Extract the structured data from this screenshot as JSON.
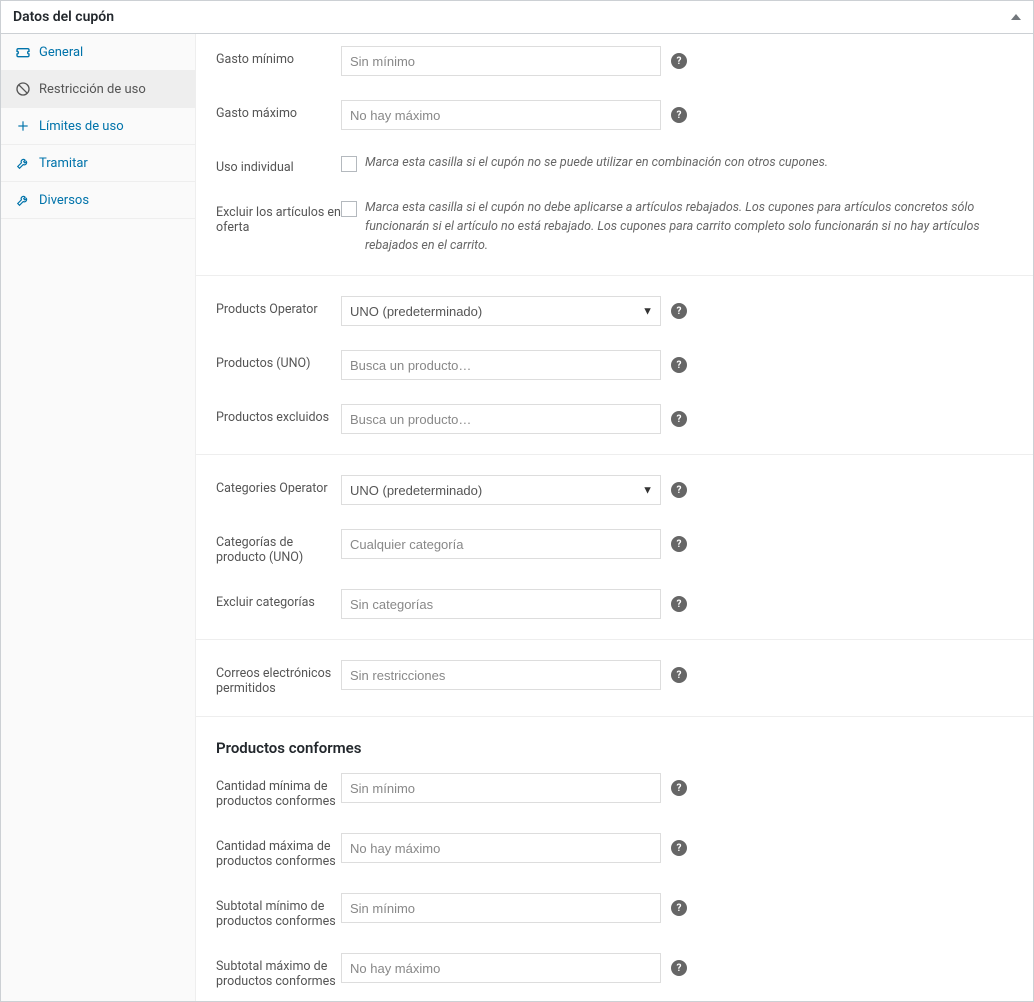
{
  "panel_title": "Datos del cupón",
  "sidebar": {
    "items": [
      {
        "label": "General",
        "icon": "ticket"
      },
      {
        "label": "Restricción de uso",
        "icon": "ban"
      },
      {
        "label": "Límites de uso",
        "icon": "plus"
      },
      {
        "label": "Tramitar",
        "icon": "wrench"
      },
      {
        "label": "Diversos",
        "icon": "wrench"
      }
    ]
  },
  "fields": {
    "min_spend": {
      "label": "Gasto mínimo",
      "placeholder": "Sin mínimo"
    },
    "max_spend": {
      "label": "Gasto máximo",
      "placeholder": "No hay máximo"
    },
    "individual": {
      "label": "Uso individual",
      "desc": "Marca esta casilla si el cupón no se puede utilizar en combinación con otros cupones."
    },
    "exclude_sale": {
      "label": "Excluir los artículos en oferta",
      "desc": "Marca esta casilla si el cupón no debe aplicarse a artículos rebajados. Los cupones para artículos concretos sólo funcionarán si el artículo no está rebajado. Los cupones para carrito completo solo funcionarán si no hay artículos rebajados en el carrito."
    },
    "products_operator": {
      "label": "Products Operator",
      "value": "UNO (predeterminado)"
    },
    "products": {
      "label": "Productos (UNO)",
      "placeholder": "Busca un producto…"
    },
    "excluded_products": {
      "label": "Productos excluidos",
      "placeholder": "Busca un producto…"
    },
    "categories_operator": {
      "label": "Categories Operator",
      "value": "UNO (predeterminado)"
    },
    "categories": {
      "label": "Categorías de producto (UNO)",
      "placeholder": "Cualquier categoría"
    },
    "exclude_categories": {
      "label": "Excluir categorías",
      "placeholder": "Sin categorías"
    },
    "emails": {
      "label": "Correos electrónicos permitidos",
      "placeholder": "Sin restricciones"
    },
    "section_heading": "Productos conformes",
    "min_qty": {
      "label": "Cantidad mínima de productos conformes",
      "placeholder": "Sin mínimo"
    },
    "max_qty": {
      "label": "Cantidad máxima de productos conformes",
      "placeholder": "No hay máximo"
    },
    "min_subtotal": {
      "label": "Subtotal mínimo de productos conformes",
      "placeholder": "Sin mínimo"
    },
    "max_subtotal": {
      "label": "Subtotal máximo de productos conformes",
      "placeholder": "No hay máximo"
    }
  }
}
